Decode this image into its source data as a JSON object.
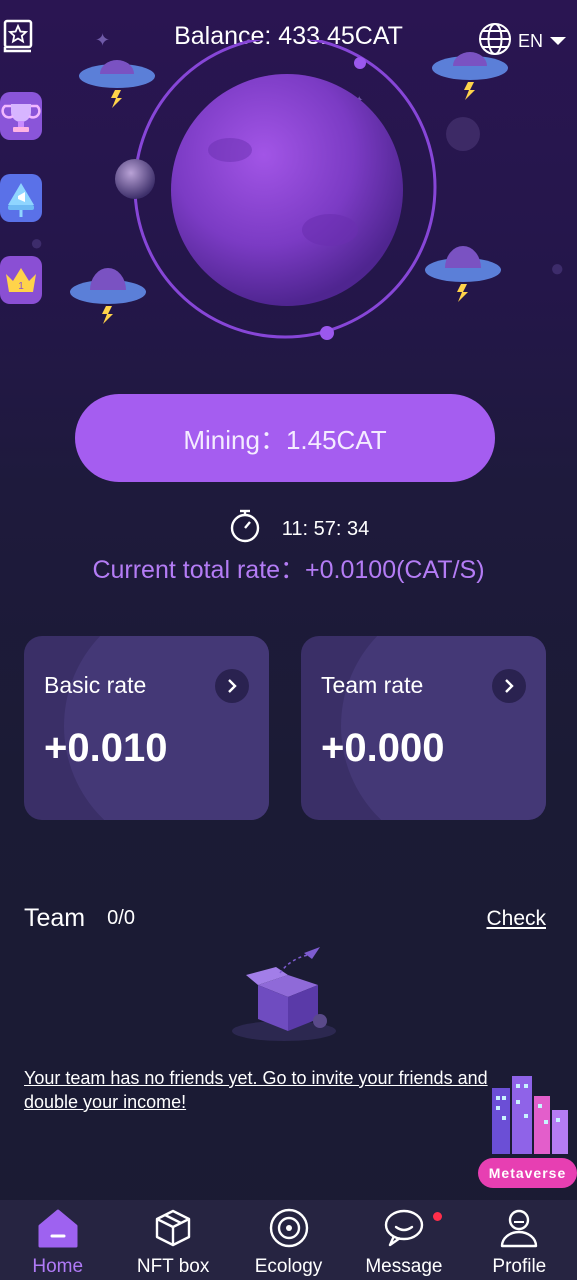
{
  "header": {
    "balance_label": "Balance: 433.45CAT",
    "language": "EN",
    "icons": [
      "book-star-icon",
      "globe-icon",
      "chevron-down-icon"
    ]
  },
  "side_icons": [
    "trophy-icon",
    "megaphone-icon",
    "crown-icon"
  ],
  "side_icon_badge": "1",
  "mining": {
    "button_label": "Mining：1.45CAT",
    "timer": "11: 57: 34",
    "total_rate": "Current total rate：+0.0100(CAT/S)"
  },
  "cards": [
    {
      "title": "Basic rate",
      "value": "+0.010"
    },
    {
      "title": "Team rate",
      "value": "+0.000"
    }
  ],
  "team": {
    "label": "Team",
    "count": "0/0",
    "check_label": "Check",
    "empty_message": "Your team has no friends yet. Go to invite your friends and double your income!"
  },
  "metaverse": {
    "label": "Metaverse"
  },
  "tabs": [
    {
      "label": "Home",
      "icon": "home-icon",
      "active": true
    },
    {
      "label": "NFT box",
      "icon": "cube-icon",
      "active": false
    },
    {
      "label": "Ecology",
      "icon": "ecology-icon",
      "active": false
    },
    {
      "label": "Message",
      "icon": "chat-icon",
      "active": false,
      "unread": true
    },
    {
      "label": "Profile",
      "icon": "profile-icon",
      "active": false
    }
  ],
  "colors": {
    "accent": "#a55df0",
    "rate_text": "#b47cf5",
    "card_bg": "#3a2f67",
    "tab_active": "#b07af6",
    "badge": "#ff2e4a",
    "metaverse_badge": "#e73fb2"
  }
}
